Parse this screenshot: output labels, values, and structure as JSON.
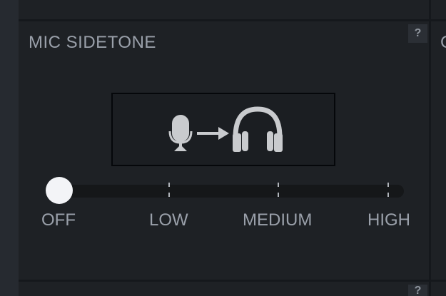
{
  "section": {
    "title": "MIC SIDETONE",
    "help_label": "?",
    "right_partial_letter": "C"
  },
  "sidetone_slider": {
    "value_index": 0,
    "selected": "OFF",
    "levels": [
      "OFF",
      "LOW",
      "MEDIUM",
      "HIGH"
    ]
  },
  "icons": {
    "illustration": [
      "microphone-icon",
      "arrow-right-icon",
      "headphones-icon"
    ],
    "help": "question-mark-icon"
  },
  "colors": {
    "background": "#15181c",
    "panel": "#1e2125",
    "text": "#9aa0aa",
    "knob": "#f3f4f7",
    "icon": "#c9cbce"
  }
}
